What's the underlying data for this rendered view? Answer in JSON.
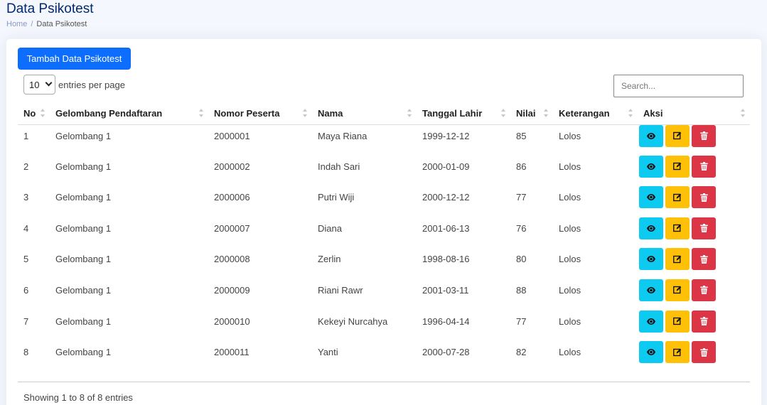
{
  "page": {
    "title": "Data Psikotest"
  },
  "breadcrumb": {
    "home": "Home",
    "separator": "/",
    "current": "Data Psikotest"
  },
  "toolbar": {
    "add_label": "Tambah Data Psikotest"
  },
  "length": {
    "value": "10",
    "suffix": "entries per page"
  },
  "search": {
    "placeholder": "Search..."
  },
  "table": {
    "headers": [
      "No",
      "Gelombang Pendaftaran",
      "Nomor Peserta",
      "Nama",
      "Tanggal Lahir",
      "Nilai",
      "Keterangan",
      "Aksi"
    ],
    "rows": [
      [
        "1",
        "Gelombang 1",
        "2000001",
        "Maya Riana",
        "1999-12-12",
        "85",
        "Lolos"
      ],
      [
        "2",
        "Gelombang 1",
        "2000002",
        "Indah Sari",
        "2000-01-09",
        "86",
        "Lolos"
      ],
      [
        "3",
        "Gelombang 1",
        "2000006",
        "Putri Wiji",
        "2000-12-12",
        "77",
        "Lolos"
      ],
      [
        "4",
        "Gelombang 1",
        "2000007",
        "Diana",
        "2001-06-13",
        "76",
        "Lolos"
      ],
      [
        "5",
        "Gelombang 1",
        "2000008",
        "Zerlin",
        "1998-08-16",
        "80",
        "Lolos"
      ],
      [
        "6",
        "Gelombang 1",
        "2000009",
        "Riani Rawr",
        "2001-03-11",
        "88",
        "Lolos"
      ],
      [
        "7",
        "Gelombang 1",
        "2000010",
        "Kekeyi Nurcahya",
        "1996-04-14",
        "77",
        "Lolos"
      ],
      [
        "8",
        "Gelombang 1",
        "2000011",
        "Yanti",
        "2000-07-28",
        "82",
        "Lolos"
      ]
    ]
  },
  "actions": {
    "view_icon": "eye-icon",
    "edit_icon": "pencil-square-icon",
    "delete_icon": "trash-icon"
  },
  "footer": {
    "info": "Showing 1 to 8 of 8 entries"
  },
  "colors": {
    "primary": "#0d6efd",
    "info": "#0dcaf0",
    "warning": "#ffc107",
    "danger": "#dc3545",
    "title": "#012970"
  }
}
